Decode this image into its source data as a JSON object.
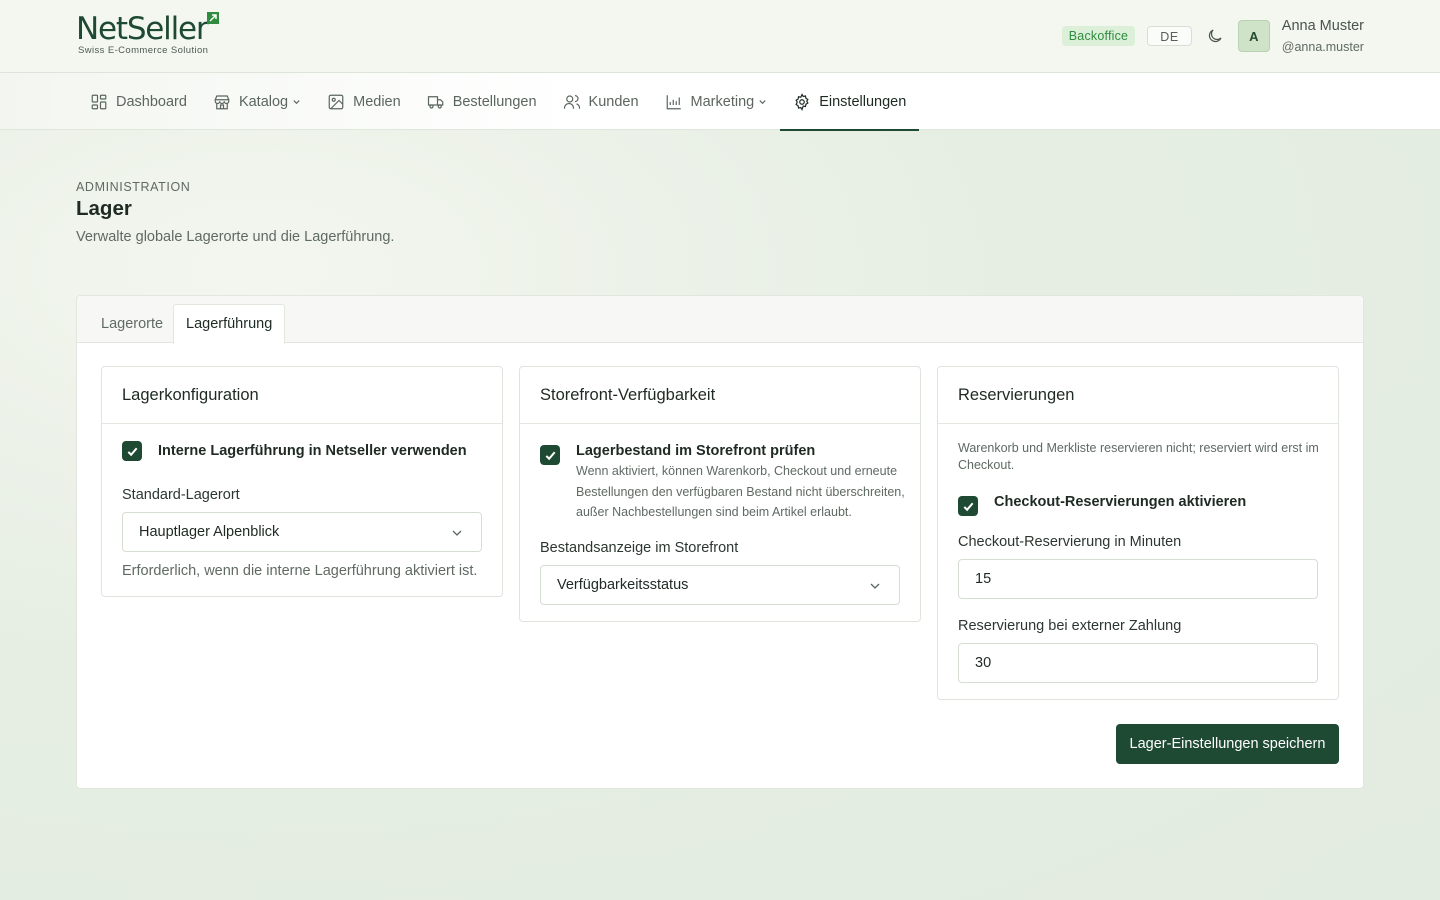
{
  "brand": {
    "name": "NetSeller",
    "tagline": "Swiss E-Commerce Solution"
  },
  "header": {
    "badge": "Backoffice",
    "language": "DE",
    "user": {
      "initial": "A",
      "name": "Anna Muster",
      "handle": "@anna.muster"
    }
  },
  "nav": {
    "items": [
      {
        "label": "Dashboard",
        "icon": "dashboard-icon"
      },
      {
        "label": "Katalog",
        "icon": "store-icon",
        "dropdown": true
      },
      {
        "label": "Medien",
        "icon": "image-icon"
      },
      {
        "label": "Bestellungen",
        "icon": "truck-icon"
      },
      {
        "label": "Kunden",
        "icon": "users-icon"
      },
      {
        "label": "Marketing",
        "icon": "chart-icon",
        "dropdown": true
      },
      {
        "label": "Einstellungen",
        "icon": "gear-icon",
        "active": true
      }
    ]
  },
  "page": {
    "eyebrow": "ADMINISTRATION",
    "title": "Lager",
    "description": "Verwalte globale Lagerorte und die Lagerführung."
  },
  "tabs": [
    {
      "label": "Lagerorte",
      "active": false
    },
    {
      "label": "Lagerführung",
      "active": true
    }
  ],
  "panels": {
    "config": {
      "title": "Lagerkonfiguration",
      "checkbox_label": "Interne Lagerführung in Netseller verwenden",
      "checked": true,
      "field_label": "Standard-Lagerort",
      "select_value": "Hauptlager Alpenblick",
      "hint": "Erforderlich, wenn die interne Lagerführung aktiviert ist."
    },
    "storefront": {
      "title": "Storefront-Verfügbarkeit",
      "checkbox_label": "Lagerbestand im Storefront prüfen",
      "checked": true,
      "checkbox_help": "Wenn aktiviert, können Warenkorb, Checkout und erneute Bestellungen den verfügbaren Bestand nicht überschreiten, außer Nachbestellungen sind beim Artikel erlaubt.",
      "field_label": "Bestandsanzeige im Storefront",
      "select_value": "Verfügbarkeitsstatus"
    },
    "reservations": {
      "title": "Reservierungen",
      "note": "Warenkorb und Merkliste reservieren nicht; reserviert wird erst im Checkout.",
      "checkbox_label": "Checkout-Reservierungen aktivieren",
      "checked": true,
      "field1_label": "Checkout-Reservierung in Minuten",
      "field1_value": "15",
      "field2_label": "Reservierung bei externer Zahlung",
      "field2_value": "30"
    }
  },
  "actions": {
    "save_label": "Lager-Einstellungen speichern"
  },
  "colors": {
    "brand": "#1e4a33",
    "badge_bg": "#dcefd9",
    "badge_text": "#2f8c3f"
  }
}
